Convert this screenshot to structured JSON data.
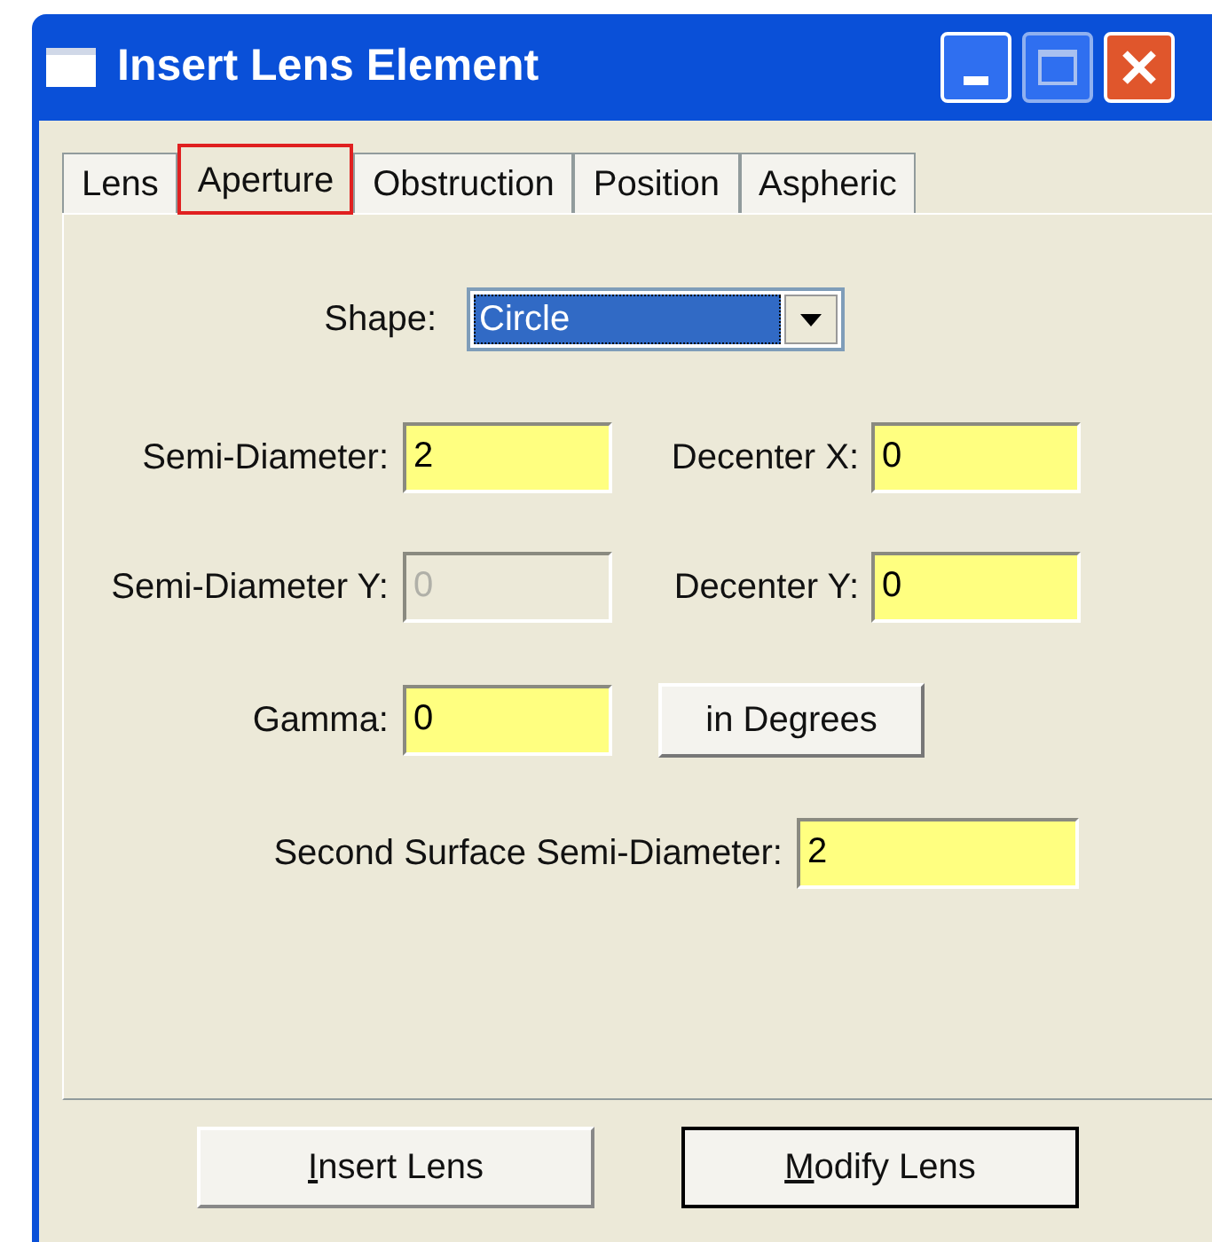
{
  "window": {
    "title": "Insert Lens Element"
  },
  "tabs": [
    {
      "label": "Lens",
      "selected": false,
      "highlighted": false
    },
    {
      "label": "Aperture",
      "selected": true,
      "highlighted": true
    },
    {
      "label": "Obstruction",
      "selected": false,
      "highlighted": false
    },
    {
      "label": "Position",
      "selected": false,
      "highlighted": false
    },
    {
      "label": "Aspheric",
      "selected": false,
      "highlighted": false
    }
  ],
  "shape": {
    "label": "Shape:",
    "value": "Circle"
  },
  "fields": [
    {
      "label": "Semi-Diameter:",
      "value": "2",
      "disabled": false
    },
    {
      "label": "Decenter X:",
      "value": "0",
      "disabled": false
    },
    {
      "label": "Semi-Diameter Y:",
      "value": "0",
      "disabled": true
    },
    {
      "label": "Decenter Y:",
      "value": "0",
      "disabled": false
    },
    {
      "label": "Gamma:",
      "value": "0",
      "disabled": false
    }
  ],
  "angle_button": "in Degrees",
  "second_surface": {
    "label": "Second Surface Semi-Diameter:",
    "value": "2",
    "disabled": false
  },
  "buttons": [
    {
      "label": "Insert Lens",
      "default": false
    },
    {
      "label": "Modify Lens",
      "default": true
    }
  ]
}
